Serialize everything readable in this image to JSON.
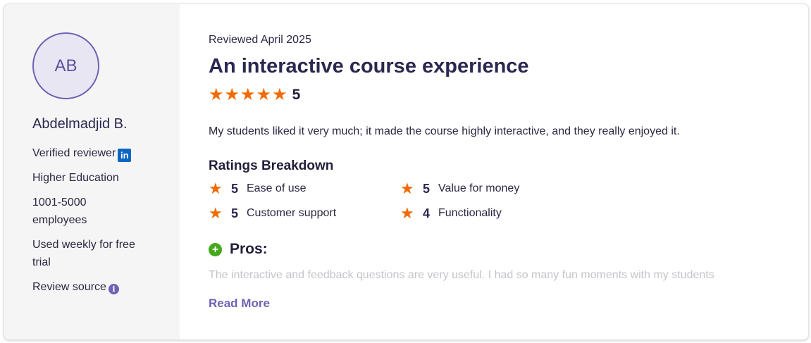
{
  "reviewer": {
    "initials": "AB",
    "name": "Abdelmadjid B.",
    "verified_label": "Verified reviewer",
    "linkedin_icon_text": "in",
    "industry": "Higher Education",
    "company_size": "1001-5000 employees",
    "usage": "Used weekly for free trial",
    "review_source_label": "Review source",
    "info_icon_text": "i"
  },
  "review": {
    "date_label": "Reviewed April 2025",
    "title": "An interactive course experience",
    "overall_rating": "5",
    "body": "My students liked it very much; it made the course highly interactive, and they really enjoyed it."
  },
  "breakdown": {
    "title": "Ratings Breakdown",
    "items": [
      {
        "label": "Ease of use",
        "value": "5"
      },
      {
        "label": "Value for money",
        "value": "5"
      },
      {
        "label": "Customer support",
        "value": "5"
      },
      {
        "label": "Functionality",
        "value": "4"
      }
    ]
  },
  "pros": {
    "label": "Pros:",
    "text": "The interactive and feedback questions are very useful. I had so many fun moments with my students"
  },
  "read_more_label": "Read More",
  "icons": {
    "star": "star-icon",
    "plus": "plus-circle-icon",
    "linkedin": "linkedin-icon",
    "info": "info-icon"
  },
  "colors": {
    "accent": "#6f62b3",
    "star": "#f26a05",
    "pros_green": "#46a81d",
    "linkedin_blue": "#0a66c2",
    "sidebar_bg": "#f5f5f6"
  }
}
